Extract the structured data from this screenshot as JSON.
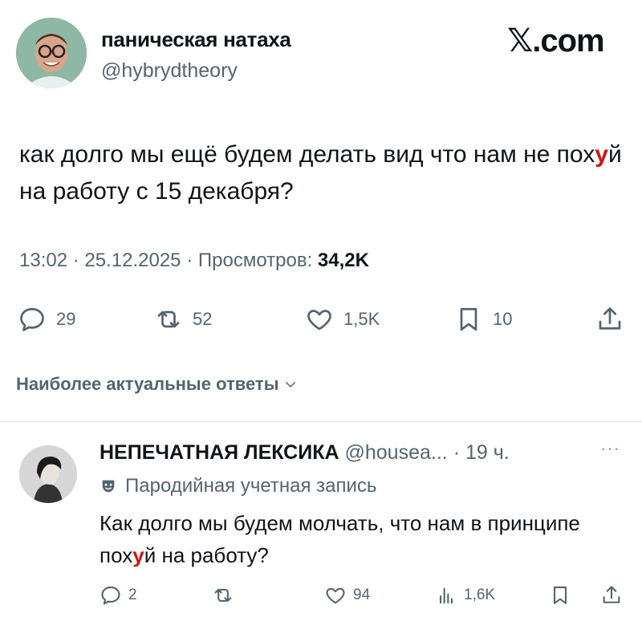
{
  "header": {
    "author_name": "паническая натаха",
    "author_handle": "@hybrydtheory",
    "brand": "𝕏.com"
  },
  "tweet": {
    "text_before": "как долго мы ещё будем делать вид что нам не пох",
    "text_censored": "у",
    "text_after": "й на работу с 15 декабря?",
    "time": "13:02",
    "date": "25.12.2025",
    "views_label": "Просмотров:",
    "views_count": "34,2K",
    "stats": {
      "replies": "29",
      "reposts": "52",
      "likes": "1,5K",
      "bookmarks": "10"
    }
  },
  "replies_section": {
    "sort_label": "Наиболее актуальные ответы"
  },
  "reply": {
    "author_name": "НЕПЕЧАТНАЯ ЛЕКСИКА",
    "author_handle": "@housea...",
    "time_ago": "· 19 ч.",
    "more": "···",
    "label": "Пародийная учетная запись",
    "text_before": "Как долго мы будем молчать, что нам в принципе пох",
    "text_censored": "у",
    "text_after": "й на работу?",
    "stats": {
      "replies": "2",
      "likes": "94",
      "views": "1,6K"
    }
  },
  "colors": {
    "text": "#0f1419",
    "secondary": "#536471",
    "censor": "#d01414",
    "divider": "#dfe3e6"
  }
}
